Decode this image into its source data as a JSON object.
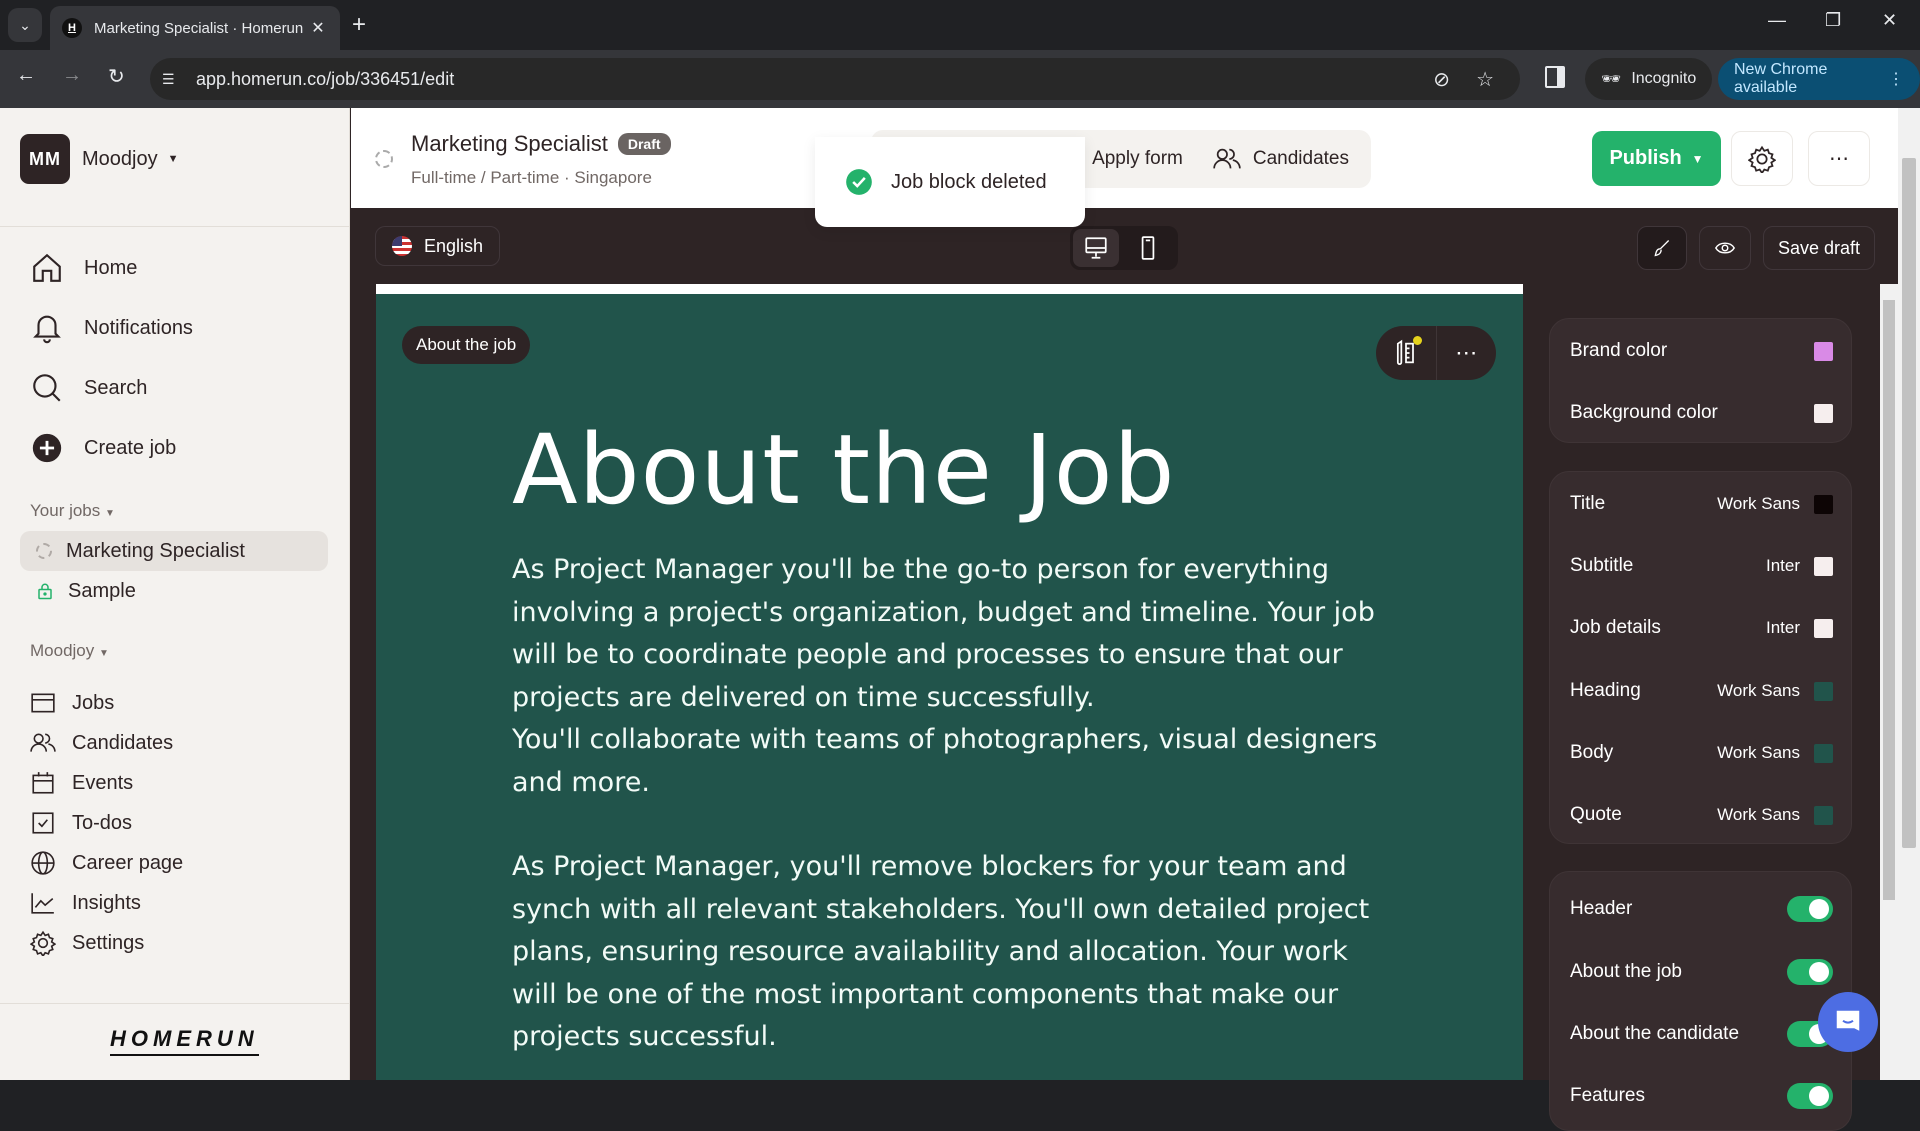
{
  "browser": {
    "tab_title": "Marketing Specialist · Homerun",
    "tab_favicon": "H",
    "url": "app.homerun.co/job/336451/edit",
    "incognito_label": "Incognito",
    "update_label": "New Chrome available"
  },
  "sidebar": {
    "org_initials": "MM",
    "org_name": "Moodjoy",
    "main_nav": [
      {
        "label": "Home",
        "icon": "home-icon"
      },
      {
        "label": "Notifications",
        "icon": "bell-icon"
      },
      {
        "label": "Search",
        "icon": "search-icon"
      },
      {
        "label": "Create job",
        "icon": "plus-circle-icon"
      }
    ],
    "your_jobs_label": "Your jobs",
    "jobs": [
      {
        "label": "Marketing Specialist",
        "status": "draft",
        "active": true
      },
      {
        "label": "Sample",
        "status": "locked",
        "active": false
      }
    ],
    "org_section_label": "Moodjoy",
    "org_nav": [
      {
        "label": "Jobs",
        "icon": "jobs-icon"
      },
      {
        "label": "Candidates",
        "icon": "users-icon"
      },
      {
        "label": "Events",
        "icon": "calendar-icon"
      },
      {
        "label": "To-dos",
        "icon": "checkbox-icon"
      },
      {
        "label": "Career page",
        "icon": "globe-icon"
      },
      {
        "label": "Insights",
        "icon": "chart-icon"
      },
      {
        "label": "Settings",
        "icon": "gear-icon"
      }
    ],
    "logo": "HOMERUN"
  },
  "header": {
    "job_title": "Marketing Specialist",
    "status_badge": "Draft",
    "job_subtitle": "Full-time / Part-time · Singapore",
    "tabs": {
      "apply_form": "Apply form",
      "candidates": "Candidates"
    },
    "publish_label": "Publish"
  },
  "toast": {
    "message": "Job block deleted"
  },
  "editor": {
    "language": "English",
    "save_draft_label": "Save draft",
    "block_label": "About the job",
    "block_title": "About the Job",
    "paragraphs": [
      "As Project Manager you'll be the go-to person for everything involving a project's organization, budget and timeline. Your job will be to coordinate people and processes to ensure that our projects are delivered on time successfully.",
      "You'll collaborate with teams of photographers, visual designers and more.",
      "As Project Manager, you'll remove blockers for your team and synch with all relevant stakeholders. You'll own detailed project plans, ensuring resource availability and allocation. Your work will be one of the most important components that make our projects successful."
    ]
  },
  "style_panel": {
    "colors": [
      {
        "label": "Brand color",
        "color": "#d98ae6"
      },
      {
        "label": "Background color",
        "color": "#f6eeee"
      }
    ],
    "typography": [
      {
        "label": "Title",
        "font": "Work Sans",
        "color": "#0d0505"
      },
      {
        "label": "Subtitle",
        "font": "Inter",
        "color": "#f6eeee"
      },
      {
        "label": "Job details",
        "font": "Inter",
        "color": "#f6eeee"
      },
      {
        "label": "Heading",
        "font": "Work Sans",
        "color": "#21544b"
      },
      {
        "label": "Body",
        "font": "Work Sans",
        "color": "#21544b"
      },
      {
        "label": "Quote",
        "font": "Work Sans",
        "color": "#21544b"
      }
    ],
    "sections": [
      {
        "label": "Header",
        "enabled": true
      },
      {
        "label": "About the job",
        "enabled": true
      },
      {
        "label": "About the candidate",
        "enabled": true
      },
      {
        "label": "Features",
        "enabled": true
      }
    ]
  }
}
